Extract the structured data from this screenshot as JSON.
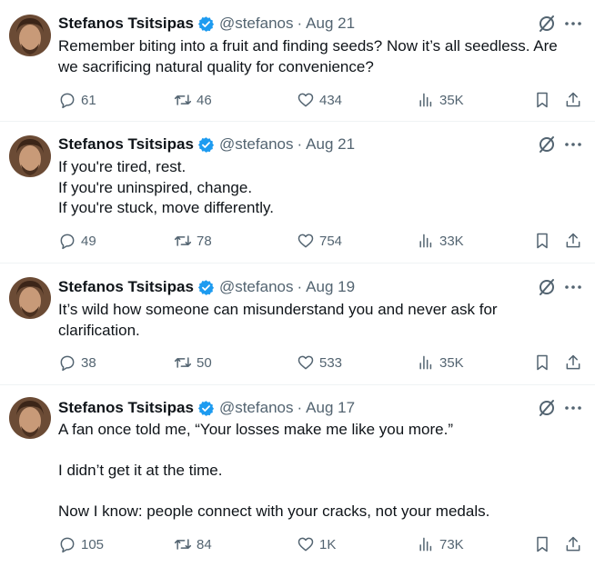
{
  "tweets": [
    {
      "author": "Stefanos Tsitsipas",
      "handle": "@stefanos",
      "separator": "·",
      "date": "Aug 21",
      "lines": [
        "Remember biting into a fruit and finding seeds? Now it’s all seedless. Are",
        "we sacrificing natural quality for convenience?"
      ],
      "replies": "61",
      "retweets": "46",
      "likes": "434",
      "views": "35K"
    },
    {
      "author": "Stefanos Tsitsipas",
      "handle": "@stefanos",
      "separator": "·",
      "date": "Aug 21",
      "lines": [
        "If you're tired, rest.",
        "If you're uninspired, change.",
        "If you're stuck, move differently."
      ],
      "replies": "49",
      "retweets": "78",
      "likes": "754",
      "views": "33K"
    },
    {
      "author": "Stefanos Tsitsipas",
      "handle": "@stefanos",
      "separator": "·",
      "date": "Aug 19",
      "lines": [
        "It’s wild how someone can misunderstand you and never ask for",
        "clarification."
      ],
      "replies": "38",
      "retweets": "50",
      "likes": "533",
      "views": "35K"
    },
    {
      "author": "Stefanos Tsitsipas",
      "handle": "@stefanos",
      "separator": "·",
      "date": "Aug 17",
      "lines": [
        "A fan once told me, “Your losses make me like you more.”",
        "",
        "I didn’t get it at the time.",
        "",
        "Now I know: people connect with your cracks, not your medals."
      ],
      "replies": "105",
      "retweets": "84",
      "likes": "1K",
      "views": "73K"
    }
  ],
  "icons": {
    "verified": "verified-badge-icon",
    "grok": "grok-icon",
    "more": "more-icon",
    "reply": "reply-icon",
    "retweet": "retweet-icon",
    "like": "like-icon",
    "views": "views-icon",
    "bookmark": "bookmark-icon",
    "share": "share-icon"
  },
  "colors": {
    "verified": "#1d9bf0",
    "secondary_text": "#536471",
    "text": "#0f1419",
    "divider": "#eff3f4"
  }
}
